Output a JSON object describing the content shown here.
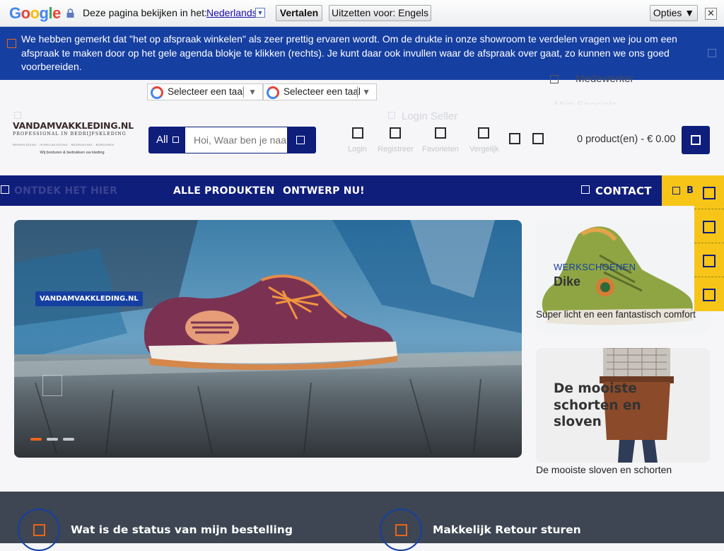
{
  "translate_bar": {
    "logo": [
      "G",
      "o",
      "o",
      "g",
      "l",
      "e"
    ],
    "ask": "Deze pagina bekijken in het:",
    "language": "Nederlands",
    "translate_button": "Vertalen",
    "off_button": "Uitzetten voor: Engels",
    "options_button": "Opties ▼",
    "close": "✕"
  },
  "notice": {
    "text": "We hebben gemerkt dat \"het op afspraak winkelen\" als zeer prettig ervaren wordt. Om de drukte in onze showroom te verdelen vragen we jou om  een afspraak te maken door op het gele agenda blokje te klikken (rechts). Je kunt daar ook invullen waar de afspraak over gaat, zo kunnen we ons goed voorbereiden."
  },
  "top_links": {
    "medewerker": "Medewerker",
    "specials": "Mijn Specials",
    "login_seller": "Login Seller"
  },
  "language_select": {
    "label": "Selecteer een taal"
  },
  "logo": {
    "name": "VANDAMVAKKLEDING.NL",
    "tagline": "PROFESSIONAL IN BEDRIJFSKLEDING",
    "sub": "WERKKLEDING  ·  HORECAKLEDING  ·  BEDRUKKING  ·  BORDUREN",
    "slogan": "Wij borduren & bedrukken uw kleding"
  },
  "search": {
    "category": "All",
    "placeholder": "Hoi, Waar ben je naar op zoek?"
  },
  "header_icons": [
    {
      "label": "Login"
    },
    {
      "label": "Registreer"
    },
    {
      "label": "Favorieten"
    },
    {
      "label": "Vergelijk"
    }
  ],
  "cart": {
    "text": "0 product(en) - € 0.00"
  },
  "nav": {
    "ontdek": "ONTDEK HET HIER",
    "alle": "ALLE PRODUKTEN",
    "ontwerp": "ONTWERP NU!",
    "contact": "CONTACT",
    "cta": "BE"
  },
  "hero": {
    "badge": "VANDAMVAKKLEDING.NL"
  },
  "promo1": {
    "category": "WERKSCHOENEN",
    "title": "Dike",
    "desc": "Super licht en een fantastisch comfort"
  },
  "promo2": {
    "title": "De mooiste schorten en sloven",
    "desc": "De mooiste sloven en schorten"
  },
  "features": [
    {
      "label": "Wat is de status van mijn bestelling"
    },
    {
      "label": "Makkelijk Retour sturen"
    }
  ],
  "colors": {
    "navy": "#0f1d7b",
    "blue": "#163fa2",
    "yellow": "#f6c518",
    "orange": "#e8651a",
    "band": "#3d4652"
  }
}
